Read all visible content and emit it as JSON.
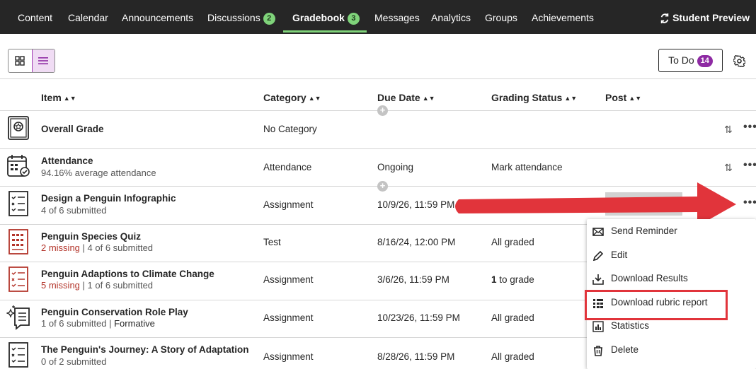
{
  "nav": {
    "items": [
      {
        "label": "Content"
      },
      {
        "label": "Calendar"
      },
      {
        "label": "Announcements"
      },
      {
        "label": "Discussions",
        "badge": "2"
      },
      {
        "label": "Gradebook",
        "badge": "3"
      },
      {
        "label": "Messages"
      },
      {
        "label": "Analytics"
      },
      {
        "label": "Groups"
      },
      {
        "label": "Achievements"
      }
    ],
    "active": "Gradebook",
    "student_preview": "Student Preview"
  },
  "toolbar": {
    "todo_label": "To Do",
    "todo_count": "14"
  },
  "columns": {
    "item": "Item",
    "category": "Category",
    "due_date": "Due Date",
    "grading_status": "Grading Status",
    "post": "Post"
  },
  "rows": [
    {
      "title": "Overall Grade",
      "subtitle": "",
      "category": "No Category",
      "due": "",
      "status": ""
    },
    {
      "title": "Attendance",
      "subtitle": "94.16% average attendance",
      "category": "Attendance",
      "due": "Ongoing",
      "status": "Mark attendance"
    },
    {
      "title": "Design a Penguin Infographic",
      "subtitle": "4 of 6 submitted",
      "category": "Assignment",
      "due": "10/9/26, 11:59 PM",
      "status": ""
    },
    {
      "title": "Penguin Species Quiz",
      "missing": "2 missing",
      "subtitle": "4 of 6 submitted",
      "category": "Test",
      "due": "8/16/24, 12:00 PM",
      "status": "All graded"
    },
    {
      "title": "Penguin Adaptions to Climate Change",
      "missing": "5 missing",
      "subtitle": "1 of 6 submitted",
      "category": "Assignment",
      "due": "3/6/26, 11:59 PM",
      "status_bold": "1",
      "status": "to grade"
    },
    {
      "title": "Penguin Conservation Role Play",
      "subtitle": "1 of 6 submitted",
      "subtitle2": "Formative",
      "category": "Assignment",
      "due": "10/23/26, 11:59 PM",
      "status": "All graded"
    },
    {
      "title": "The Penguin's Journey: A Story of Adaptation",
      "subtitle": "0 of 2 submitted",
      "category": "Assignment",
      "due": "8/28/26, 11:59 PM",
      "status": "All graded"
    }
  ],
  "menu": {
    "items": [
      {
        "label": "Send Reminder",
        "icon": "envelope-icon"
      },
      {
        "label": "Edit",
        "icon": "pencil-icon"
      },
      {
        "label": "Download Results",
        "icon": "download-icon"
      },
      {
        "label": "Download rubric report",
        "icon": "rubric-grid-icon"
      },
      {
        "label": "Statistics",
        "icon": "statistics-icon"
      },
      {
        "label": "Delete",
        "icon": "trash-icon"
      }
    ],
    "highlighted": "Download rubric report"
  },
  "colors": {
    "nav_bg": "#262626",
    "nav_accent": "#7fd37a",
    "purple_accent": "#8e2aa3",
    "missing_red": "#b3342a",
    "annotation_red": "#e1343b"
  }
}
